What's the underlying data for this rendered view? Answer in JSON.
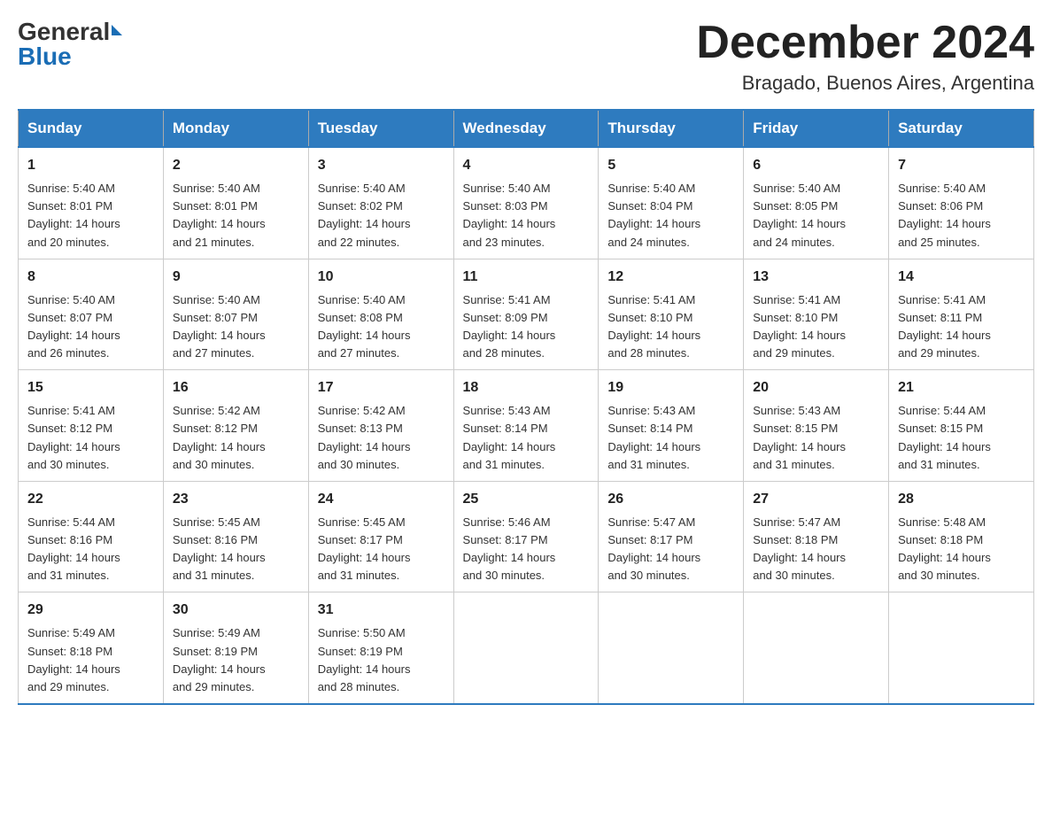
{
  "header": {
    "logo_general": "General",
    "logo_blue": "Blue",
    "month_title": "December 2024",
    "location": "Bragado, Buenos Aires, Argentina"
  },
  "weekdays": [
    "Sunday",
    "Monday",
    "Tuesday",
    "Wednesday",
    "Thursday",
    "Friday",
    "Saturday"
  ],
  "weeks": [
    [
      {
        "day": "1",
        "sunrise": "5:40 AM",
        "sunset": "8:01 PM",
        "daylight": "14 hours and 20 minutes."
      },
      {
        "day": "2",
        "sunrise": "5:40 AM",
        "sunset": "8:01 PM",
        "daylight": "14 hours and 21 minutes."
      },
      {
        "day": "3",
        "sunrise": "5:40 AM",
        "sunset": "8:02 PM",
        "daylight": "14 hours and 22 minutes."
      },
      {
        "day": "4",
        "sunrise": "5:40 AM",
        "sunset": "8:03 PM",
        "daylight": "14 hours and 23 minutes."
      },
      {
        "day": "5",
        "sunrise": "5:40 AM",
        "sunset": "8:04 PM",
        "daylight": "14 hours and 24 minutes."
      },
      {
        "day": "6",
        "sunrise": "5:40 AM",
        "sunset": "8:05 PM",
        "daylight": "14 hours and 24 minutes."
      },
      {
        "day": "7",
        "sunrise": "5:40 AM",
        "sunset": "8:06 PM",
        "daylight": "14 hours and 25 minutes."
      }
    ],
    [
      {
        "day": "8",
        "sunrise": "5:40 AM",
        "sunset": "8:07 PM",
        "daylight": "14 hours and 26 minutes."
      },
      {
        "day": "9",
        "sunrise": "5:40 AM",
        "sunset": "8:07 PM",
        "daylight": "14 hours and 27 minutes."
      },
      {
        "day": "10",
        "sunrise": "5:40 AM",
        "sunset": "8:08 PM",
        "daylight": "14 hours and 27 minutes."
      },
      {
        "day": "11",
        "sunrise": "5:41 AM",
        "sunset": "8:09 PM",
        "daylight": "14 hours and 28 minutes."
      },
      {
        "day": "12",
        "sunrise": "5:41 AM",
        "sunset": "8:10 PM",
        "daylight": "14 hours and 28 minutes."
      },
      {
        "day": "13",
        "sunrise": "5:41 AM",
        "sunset": "8:10 PM",
        "daylight": "14 hours and 29 minutes."
      },
      {
        "day": "14",
        "sunrise": "5:41 AM",
        "sunset": "8:11 PM",
        "daylight": "14 hours and 29 minutes."
      }
    ],
    [
      {
        "day": "15",
        "sunrise": "5:41 AM",
        "sunset": "8:12 PM",
        "daylight": "14 hours and 30 minutes."
      },
      {
        "day": "16",
        "sunrise": "5:42 AM",
        "sunset": "8:12 PM",
        "daylight": "14 hours and 30 minutes."
      },
      {
        "day": "17",
        "sunrise": "5:42 AM",
        "sunset": "8:13 PM",
        "daylight": "14 hours and 30 minutes."
      },
      {
        "day": "18",
        "sunrise": "5:43 AM",
        "sunset": "8:14 PM",
        "daylight": "14 hours and 31 minutes."
      },
      {
        "day": "19",
        "sunrise": "5:43 AM",
        "sunset": "8:14 PM",
        "daylight": "14 hours and 31 minutes."
      },
      {
        "day": "20",
        "sunrise": "5:43 AM",
        "sunset": "8:15 PM",
        "daylight": "14 hours and 31 minutes."
      },
      {
        "day": "21",
        "sunrise": "5:44 AM",
        "sunset": "8:15 PM",
        "daylight": "14 hours and 31 minutes."
      }
    ],
    [
      {
        "day": "22",
        "sunrise": "5:44 AM",
        "sunset": "8:16 PM",
        "daylight": "14 hours and 31 minutes."
      },
      {
        "day": "23",
        "sunrise": "5:45 AM",
        "sunset": "8:16 PM",
        "daylight": "14 hours and 31 minutes."
      },
      {
        "day": "24",
        "sunrise": "5:45 AM",
        "sunset": "8:17 PM",
        "daylight": "14 hours and 31 minutes."
      },
      {
        "day": "25",
        "sunrise": "5:46 AM",
        "sunset": "8:17 PM",
        "daylight": "14 hours and 30 minutes."
      },
      {
        "day": "26",
        "sunrise": "5:47 AM",
        "sunset": "8:17 PM",
        "daylight": "14 hours and 30 minutes."
      },
      {
        "day": "27",
        "sunrise": "5:47 AM",
        "sunset": "8:18 PM",
        "daylight": "14 hours and 30 minutes."
      },
      {
        "day": "28",
        "sunrise": "5:48 AM",
        "sunset": "8:18 PM",
        "daylight": "14 hours and 30 minutes."
      }
    ],
    [
      {
        "day": "29",
        "sunrise": "5:49 AM",
        "sunset": "8:18 PM",
        "daylight": "14 hours and 29 minutes."
      },
      {
        "day": "30",
        "sunrise": "5:49 AM",
        "sunset": "8:19 PM",
        "daylight": "14 hours and 29 minutes."
      },
      {
        "day": "31",
        "sunrise": "5:50 AM",
        "sunset": "8:19 PM",
        "daylight": "14 hours and 28 minutes."
      },
      null,
      null,
      null,
      null
    ]
  ],
  "labels": {
    "sunrise": "Sunrise:",
    "sunset": "Sunset:",
    "daylight": "Daylight:"
  }
}
